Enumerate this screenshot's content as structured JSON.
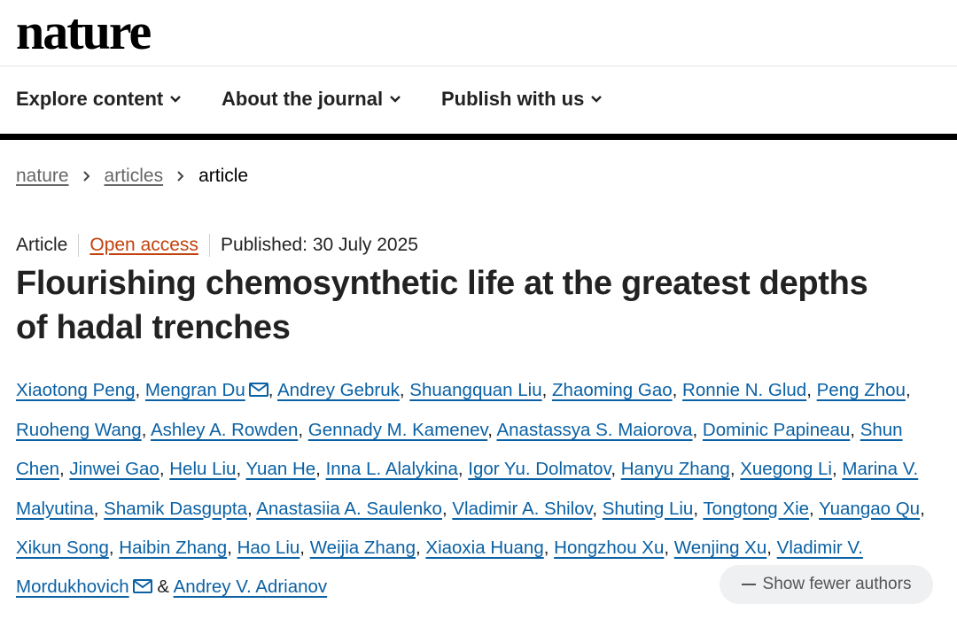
{
  "brand": "nature",
  "nav": [
    {
      "label": "Explore content"
    },
    {
      "label": "About the journal"
    },
    {
      "label": "Publish with us"
    }
  ],
  "breadcrumb": [
    {
      "label": "nature",
      "link": true
    },
    {
      "label": "articles",
      "link": true
    },
    {
      "label": "article",
      "link": false
    }
  ],
  "meta": {
    "type": "Article",
    "access": "Open access",
    "published": "Published: 30 July 2025"
  },
  "title_line1": "Flourishing chemosynthetic life at the greatest depths",
  "title_line2": "of hadal trenches",
  "authors": [
    {
      "name": "Xiaotong Peng"
    },
    {
      "name": "Mengran Du",
      "corresponding": true
    },
    {
      "name": "Andrey Gebruk"
    },
    {
      "name": "Shuangquan Liu"
    },
    {
      "name": "Zhaoming Gao"
    },
    {
      "name": "Ronnie N. Glud"
    },
    {
      "name": "Peng Zhou"
    },
    {
      "name": "Ruoheng Wang"
    },
    {
      "name": "Ashley A. Rowden"
    },
    {
      "name": "Gennady M. Kamenev"
    },
    {
      "name": "Anastassya S. Maiorova"
    },
    {
      "name": "Dominic Papineau"
    },
    {
      "name": "Shun Chen"
    },
    {
      "name": "Jinwei Gao"
    },
    {
      "name": "Helu Liu"
    },
    {
      "name": "Yuan He"
    },
    {
      "name": "Inna L. Alalykina"
    },
    {
      "name": "Igor Yu. Dolmatov"
    },
    {
      "name": "Hanyu Zhang"
    },
    {
      "name": "Xuegong Li"
    },
    {
      "name": "Marina V. Malyutina"
    },
    {
      "name": "Shamik Dasgupta"
    },
    {
      "name": "Anastasiia A. Saulenko"
    },
    {
      "name": "Vladimir A. Shilov"
    },
    {
      "name": "Shuting Liu"
    },
    {
      "name": "Tongtong Xie"
    },
    {
      "name": "Yuangao Qu"
    },
    {
      "name": "Xikun Song"
    },
    {
      "name": "Haibin Zhang"
    },
    {
      "name": "Hao Liu"
    },
    {
      "name": "Weijia Zhang"
    },
    {
      "name": "Xiaoxia Huang"
    },
    {
      "name": "Hongzhou Xu"
    },
    {
      "name": "Wenjing Xu"
    },
    {
      "name": "Vladimir V. Mordukhovich",
      "corresponding": true
    },
    {
      "name": "Andrey V. Adrianov"
    }
  ],
  "authors_separator": ", ",
  "authors_last_separator": " & ",
  "toggle_label": "Show fewer authors",
  "colors": {
    "link": "#0b61a4",
    "open_access": "#c2410c",
    "rule": "#000000"
  }
}
